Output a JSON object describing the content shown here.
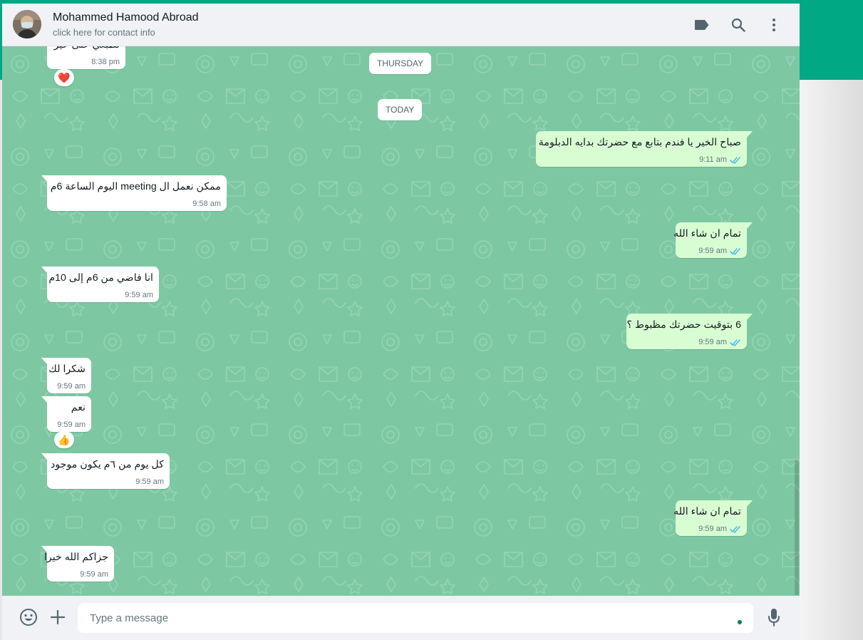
{
  "header": {
    "contact_name": "Mohammed Hamood Abroad",
    "contact_subtitle": "click here for contact info",
    "icons": [
      "label-icon",
      "search-icon",
      "menu-icon"
    ]
  },
  "chat": {
    "dividers": [
      "THURSDAY",
      "TODAY"
    ],
    "cut_message": {
      "text": "تطبعي على خير",
      "time": "8:38 pm",
      "reaction": "❤️"
    },
    "messages": [
      {
        "direction": "out",
        "text": "صباح الخير يا فندم بتابع مع حضرتك بدايه الدبلومة",
        "time": "9:11 am",
        "status": "read"
      },
      {
        "direction": "in",
        "text": "ممكن نعمل ال meeting اليوم الساعة 6م",
        "time": "9:58 am"
      },
      {
        "direction": "out",
        "text": "تمام ان شاء الله",
        "time": "9:59 am",
        "status": "read"
      },
      {
        "direction": "in",
        "text": "انا فاضي من 6م إلى 10م",
        "time": "9:59 am"
      },
      {
        "direction": "out",
        "text": "6 بتوقيت حضرتك مظبوط ؟",
        "time": "9:59 am",
        "status": "read"
      },
      {
        "direction": "in",
        "text": "شكرا لك",
        "time": "9:59 am"
      },
      {
        "direction": "in",
        "text": "نعم",
        "time": "9:59 am",
        "reaction": "👍"
      },
      {
        "direction": "in",
        "text": "كل يوم من ٦م يكون موجود",
        "time": "9:59 am"
      },
      {
        "direction": "out",
        "text": "تمام ان شاء الله",
        "time": "9:59 am",
        "status": "read"
      },
      {
        "direction": "in",
        "text": "جزاكم الله خيرا",
        "time": "9:59 am"
      }
    ]
  },
  "composer": {
    "placeholder": "Type a message",
    "icons": [
      "emoji-icon",
      "attach-plus-icon",
      "microphone-icon"
    ]
  },
  "colors": {
    "header_bg": "#f0f2f5",
    "chat_bg": "#7dc8a3",
    "incoming_bubble": "#ffffff",
    "outgoing_bubble": "#d9fdd3",
    "read_tick": "#53bdeb",
    "brand_band": "#00a884"
  }
}
